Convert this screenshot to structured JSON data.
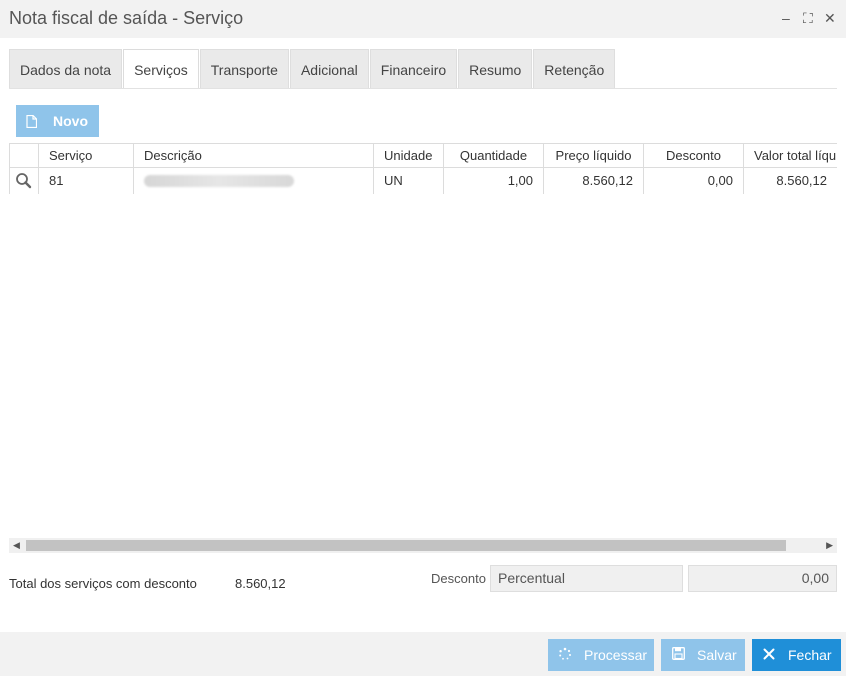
{
  "window": {
    "title": "Nota fiscal de saída - Serviço",
    "controls": {
      "minimize": "–",
      "maximize": "⛶",
      "close": "✕"
    }
  },
  "tabs": [
    {
      "label": "Dados da nota",
      "active": false
    },
    {
      "label": "Serviços",
      "active": true
    },
    {
      "label": "Transporte",
      "active": false
    },
    {
      "label": "Adicional",
      "active": false
    },
    {
      "label": "Financeiro",
      "active": false
    },
    {
      "label": "Resumo",
      "active": false
    },
    {
      "label": "Retenção",
      "active": false
    }
  ],
  "toolbar": {
    "new_label": "Novo",
    "new_icon": "document-icon"
  },
  "grid": {
    "columns": [
      "Serviço",
      "Descrição",
      "Unidade",
      "Quantidade",
      "Preço líquido",
      "Desconto",
      "Valor total líqu"
    ],
    "rows": [
      {
        "servico": "81",
        "descricao": "",
        "unidade": "UN",
        "quantidade": "1,00",
        "preco": "8.560,12",
        "desconto": "0,00",
        "total": "8.560,12"
      }
    ]
  },
  "scroll": {
    "left": "◀",
    "right": "▶"
  },
  "summary": {
    "total_label": "Total dos serviços com desconto",
    "total_value": "8.560,12",
    "discount_label": "Desconto",
    "discount_type": "Percentual",
    "discount_value": "0,00"
  },
  "footer": {
    "process_label": "Processar",
    "save_label": "Salvar",
    "close_label": "Fechar"
  },
  "colors": {
    "primary": "#1f8fd8",
    "disabled": "#8fc4ea"
  }
}
